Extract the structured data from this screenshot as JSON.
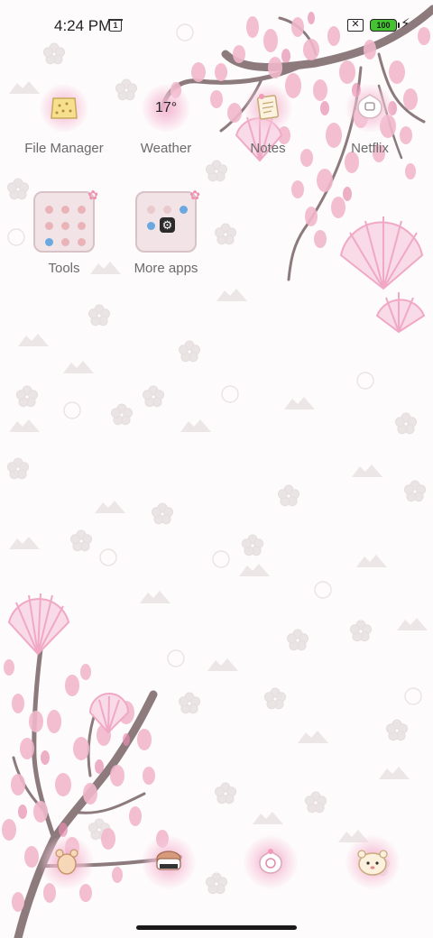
{
  "status_bar": {
    "time": "4:24 PM",
    "calendar_badge": "1",
    "battery_level": "100",
    "no_sim": "✕"
  },
  "home_apps": [
    {
      "label": "File Manager"
    },
    {
      "label": "Weather",
      "temperature": "17°"
    },
    {
      "label": "Notes"
    },
    {
      "label": "Netflix"
    }
  ],
  "folders": [
    {
      "label": "Tools"
    },
    {
      "label": "More apps"
    }
  ],
  "dock": [
    {
      "icon": "phone-icon"
    },
    {
      "icon": "messages-icon"
    },
    {
      "icon": "browser-icon"
    },
    {
      "icon": "camera-icon"
    }
  ],
  "colors": {
    "accent_pink": "#f3b6cf",
    "branch": "#8c7a7c",
    "battery": "#44c232"
  }
}
